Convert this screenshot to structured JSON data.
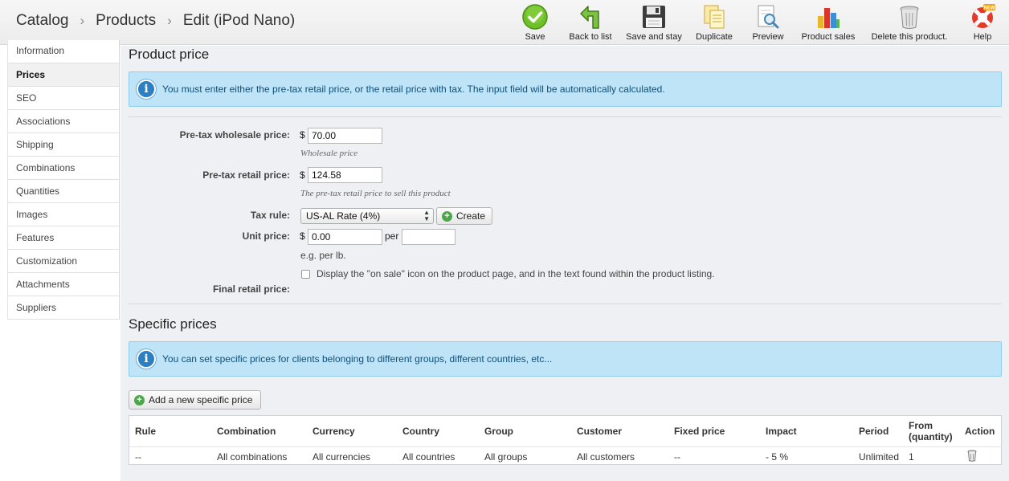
{
  "breadcrumb": {
    "item1": "Catalog",
    "item2": "Products",
    "item3": "Edit (iPod Nano)",
    "sep": "›"
  },
  "toolbar": {
    "save": "Save",
    "back": "Back to list",
    "save_stay": "Save and stay",
    "duplicate": "Duplicate",
    "preview": "Preview",
    "sales": "Product sales",
    "delete": "Delete this product.",
    "help": "Help",
    "help_badge": "NEW"
  },
  "sidebar": {
    "items": [
      "Information",
      "Prices",
      "SEO",
      "Associations",
      "Shipping",
      "Combinations",
      "Quantities",
      "Images",
      "Features",
      "Customization",
      "Attachments",
      "Suppliers"
    ]
  },
  "price_section": {
    "title": "Product price",
    "info": "You must enter either the pre-tax retail price, or the retail price with tax. The input field will be automatically calculated.",
    "wholesale_label": "Pre-tax wholesale price:",
    "currency": "$",
    "wholesale_value": "70.00",
    "wholesale_hint": "Wholesale price",
    "retail_label": "Pre-tax retail price:",
    "retail_value": "124.58",
    "retail_hint": "The pre-tax retail price to sell this product",
    "tax_label": "Tax rule:",
    "tax_value": "US-AL Rate (4%)",
    "create_label": "Create",
    "unit_label": "Unit price:",
    "unit_value": "0.00",
    "per_label": "per",
    "per_value": "",
    "unit_hint": "e.g. per lb.",
    "on_sale_label": "Display the \"on sale\" icon on the product page, and in the text found within the product listing.",
    "final_label": "Final retail price:"
  },
  "specific_section": {
    "title": "Specific prices",
    "info": "You can set specific prices for clients belonging to different groups, different countries, etc...",
    "add_label": "Add a new specific price",
    "columns": [
      "Rule",
      "Combination",
      "Currency",
      "Country",
      "Group",
      "Customer",
      "Fixed price",
      "Impact",
      "Period",
      "From",
      "(quantity)",
      "Action"
    ],
    "row": [
      "--",
      "All combinations",
      "All currencies",
      "All countries",
      "All groups",
      "All customers",
      "--",
      "- 5 %",
      "Unlimited",
      "1"
    ]
  },
  "icons": {
    "save": "check-circle-icon",
    "back": "return-arrow-icon",
    "save_stay": "floppy-disk-icon",
    "duplicate": "duplicate-icon",
    "preview": "magnifier-icon",
    "sales": "bar-chart-icon",
    "delete": "trash-icon",
    "help": "lifebuoy-icon",
    "info": "info-icon",
    "add": "plus-circle-icon"
  },
  "colors": {
    "accent_green": "#4aa84a",
    "info_bg": "#bfe4f7",
    "info_text": "#0d4f7a"
  }
}
